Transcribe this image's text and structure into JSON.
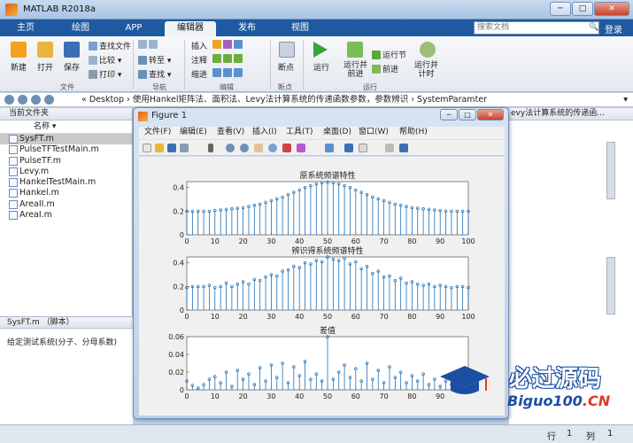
{
  "app": {
    "title": "MATLAB R2018a"
  },
  "tabs": [
    "主页",
    "绘图",
    "APP",
    "编辑器",
    "发布",
    "视图"
  ],
  "active_tab": "编辑器",
  "search": {
    "placeholder": "搜索文档"
  },
  "login": "登录",
  "ribbon": {
    "file": {
      "new": "新建",
      "open": "打开",
      "save": "保存",
      "find_files": "查找文件",
      "compare": "比较",
      "print": "打印",
      "group": "文件"
    },
    "nav": {
      "goto": "转至",
      "find": "查找",
      "group": "导航"
    },
    "edit": {
      "insert": "插入",
      "comment": "注释",
      "indent": "缩进",
      "group": "编辑"
    },
    "breakpoints": {
      "label": "断点",
      "group": "断点"
    },
    "run": {
      "run": "运行",
      "run_advance": "运行并\n前进",
      "run_section": "运行节",
      "advance": "前进",
      "run_time": "运行并\n计时",
      "group": "运行"
    }
  },
  "address": {
    "path": "« Desktop › 使用Hankel矩阵法、面积法、Levy法计算系统的传递函数参数，参数辨识 › SystemParamter"
  },
  "current_folder": {
    "header": "当前文件夹",
    "column": "名称 ▾",
    "files": [
      "SysFT.m",
      "PulseTFTestMain.m",
      "PulseTF.m",
      "Levy.m",
      "HankelTestMain.m",
      "Hankel.m",
      "AreaII.m",
      "AreaI.m"
    ],
    "selected": "SysFT.m"
  },
  "details": {
    "header": "SysFT.m （脚本）",
    "text": "给定测试系统(分子、分母系数)"
  },
  "editor_right": {
    "header": "evy法计算系统的传递函..."
  },
  "status": {
    "row_label": "行",
    "row_value": "1",
    "col_label": "列",
    "col_value": "1"
  },
  "figure": {
    "title": "Figure 1",
    "menu": [
      "文件(F)",
      "编辑(E)",
      "查看(V)",
      "插入(I)",
      "工具(T)",
      "桌面(D)",
      "窗口(W)",
      "帮助(H)"
    ]
  },
  "watermark": {
    "line1": "必过源码",
    "line2a": "Biguo100",
    "line2b": ".CN"
  },
  "chart_data": [
    {
      "type": "stem",
      "title": "原系统频谱特性",
      "xlim": [
        0,
        100
      ],
      "ylim": [
        0,
        0.45
      ],
      "xticks": [
        0,
        10,
        20,
        30,
        40,
        50,
        60,
        70,
        80,
        90,
        100
      ],
      "yticks": [
        0,
        0.2,
        0.4
      ],
      "x": [
        0,
        2,
        4,
        6,
        8,
        10,
        12,
        14,
        16,
        18,
        20,
        22,
        24,
        26,
        28,
        30,
        32,
        34,
        36,
        38,
        40,
        42,
        44,
        46,
        48,
        50,
        52,
        54,
        56,
        58,
        60,
        62,
        64,
        66,
        68,
        70,
        72,
        74,
        76,
        78,
        80,
        82,
        84,
        86,
        88,
        90,
        92,
        94,
        96,
        98,
        100
      ],
      "values": [
        0.2,
        0.2,
        0.2,
        0.2,
        0.2,
        0.205,
        0.21,
        0.215,
        0.22,
        0.225,
        0.23,
        0.24,
        0.25,
        0.26,
        0.275,
        0.29,
        0.305,
        0.32,
        0.34,
        0.36,
        0.38,
        0.4,
        0.415,
        0.43,
        0.44,
        0.445,
        0.44,
        0.43,
        0.415,
        0.4,
        0.38,
        0.36,
        0.34,
        0.32,
        0.305,
        0.29,
        0.275,
        0.26,
        0.25,
        0.24,
        0.23,
        0.225,
        0.22,
        0.215,
        0.21,
        0.205,
        0.2,
        0.2,
        0.2,
        0.2,
        0.2
      ]
    },
    {
      "type": "stem",
      "title": "辨识得系统频谱特性",
      "xlim": [
        0,
        100
      ],
      "ylim": [
        0,
        0.45
      ],
      "xticks": [
        0,
        10,
        20,
        30,
        40,
        50,
        60,
        70,
        80,
        90,
        100
      ],
      "yticks": [
        0,
        0.2,
        0.4
      ],
      "x": [
        0,
        2,
        4,
        6,
        8,
        10,
        12,
        14,
        16,
        18,
        20,
        22,
        24,
        26,
        28,
        30,
        32,
        34,
        36,
        38,
        40,
        42,
        44,
        46,
        48,
        50,
        52,
        54,
        56,
        58,
        60,
        62,
        64,
        66,
        68,
        70,
        72,
        74,
        76,
        78,
        80,
        82,
        84,
        86,
        88,
        90,
        92,
        94,
        96,
        98,
        100
      ],
      "values": [
        0.19,
        0.2,
        0.2,
        0.2,
        0.21,
        0.19,
        0.2,
        0.23,
        0.2,
        0.22,
        0.24,
        0.22,
        0.26,
        0.25,
        0.28,
        0.3,
        0.29,
        0.33,
        0.34,
        0.37,
        0.36,
        0.4,
        0.39,
        0.42,
        0.41,
        0.5,
        0.43,
        0.42,
        0.44,
        0.39,
        0.41,
        0.35,
        0.37,
        0.31,
        0.33,
        0.28,
        0.29,
        0.25,
        0.27,
        0.23,
        0.24,
        0.22,
        0.21,
        0.22,
        0.2,
        0.21,
        0.2,
        0.19,
        0.2,
        0.2,
        0.19
      ]
    },
    {
      "type": "stem",
      "title": "差值",
      "xlim": [
        0,
        100
      ],
      "ylim": [
        0,
        0.06
      ],
      "xticks": [
        0,
        10,
        20,
        30,
        40,
        50,
        60,
        70,
        80,
        90
      ],
      "yticks": [
        0,
        0.02,
        0.04,
        0.06
      ],
      "x": [
        0,
        2,
        4,
        6,
        8,
        10,
        12,
        14,
        16,
        18,
        20,
        22,
        24,
        26,
        28,
        30,
        32,
        34,
        36,
        38,
        40,
        42,
        44,
        46,
        48,
        50,
        52,
        54,
        56,
        58,
        60,
        62,
        64,
        66,
        68,
        70,
        72,
        74,
        76,
        78,
        80,
        82,
        84,
        86,
        88,
        90,
        92,
        94,
        96,
        98,
        100
      ],
      "values": [
        0.01,
        0.005,
        0.002,
        0.006,
        0.012,
        0.015,
        0.008,
        0.02,
        0.004,
        0.022,
        0.012,
        0.018,
        0.006,
        0.025,
        0.01,
        0.028,
        0.014,
        0.03,
        0.008,
        0.026,
        0.016,
        0.032,
        0.012,
        0.018,
        0.01,
        0.06,
        0.012,
        0.02,
        0.028,
        0.014,
        0.024,
        0.01,
        0.03,
        0.012,
        0.022,
        0.008,
        0.026,
        0.014,
        0.02,
        0.008,
        0.016,
        0.01,
        0.018,
        0.006,
        0.012,
        0.004,
        0.01,
        0.006,
        0.008,
        0.004,
        0.006
      ]
    }
  ]
}
